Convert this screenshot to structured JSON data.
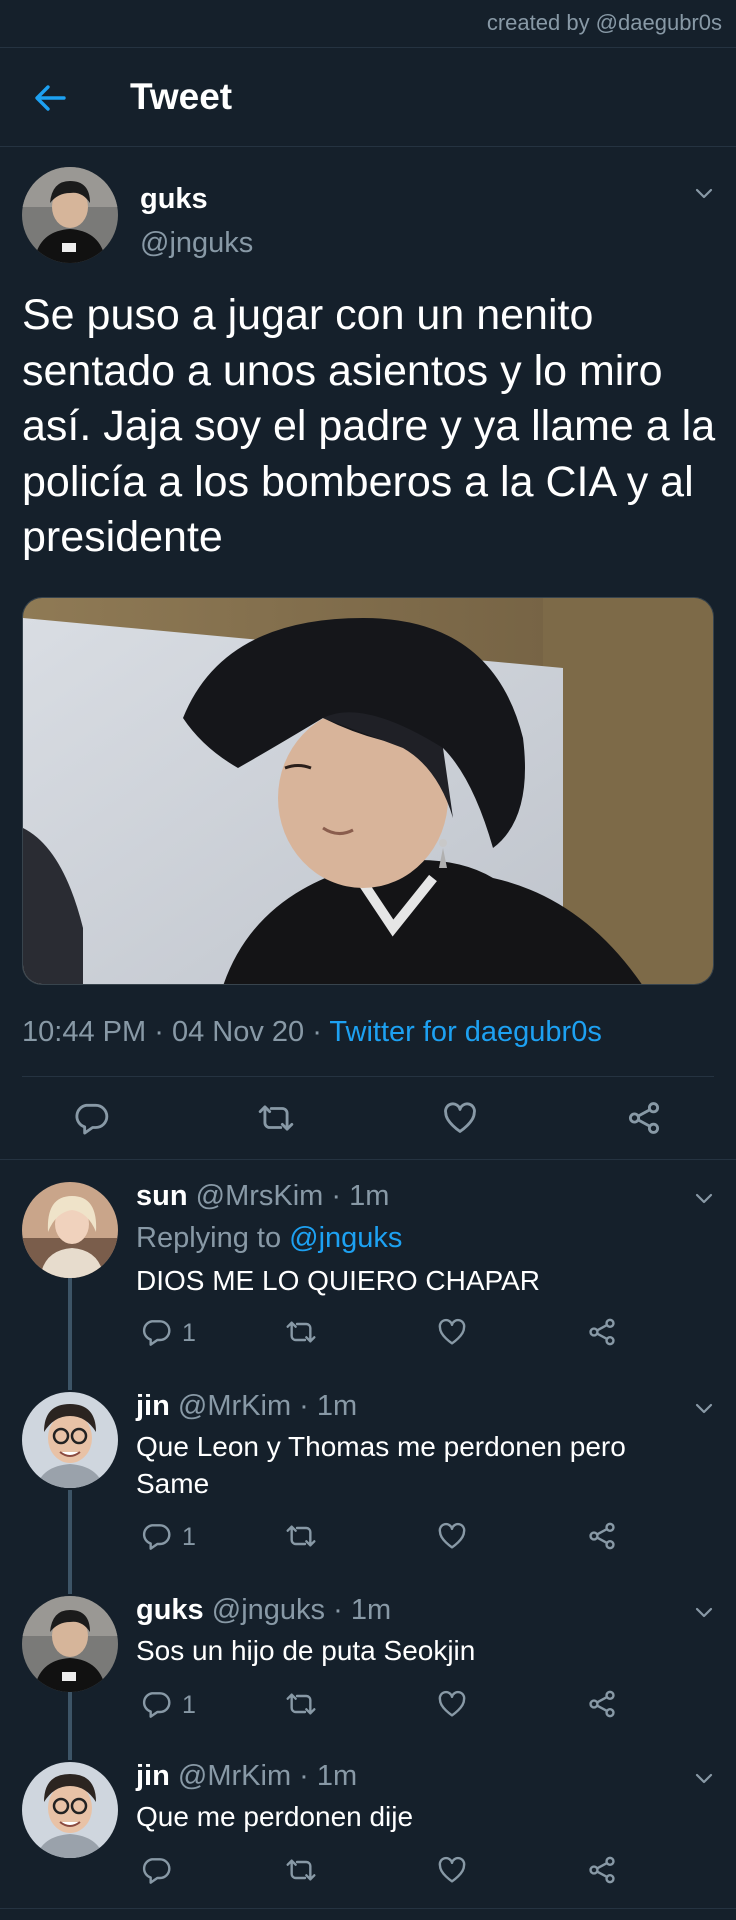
{
  "watermark": "created by @daegubr0s",
  "header": {
    "title": "Tweet",
    "back_icon": "arrow-left-icon"
  },
  "tweet": {
    "author_name": "guks",
    "author_handle": "@jnguks",
    "text": "Se puso a jugar con un nenito sentado a unos asientos y lo miro así. Jaja soy el padre y ya llame a la policía a los bomberos a la CIA y al presidente",
    "time": "10:44 PM",
    "date": "04 Nov 20",
    "separator": "·",
    "source": "Twitter for daegubr0s",
    "actions": [
      "reply-icon",
      "retweet-icon",
      "like-icon",
      "share-icon"
    ]
  },
  "replies": [
    {
      "name": "sun",
      "handle": "@MrsKim",
      "time": "1m",
      "replying_prefix": "Replying to ",
      "replying_to": "@jnguks",
      "text": "DIOS ME LO QUIERO CHAPAR",
      "reply_count": "1"
    },
    {
      "name": "jin",
      "handle": "@MrKim",
      "time": "1m",
      "text": "Que Leon y Thomas me perdonen pero Same",
      "reply_count": "1"
    },
    {
      "name": "guks",
      "handle": "@jnguks",
      "time": "1m",
      "text": "Sos un hijo de puta Seokjin",
      "reply_count": "1"
    },
    {
      "name": "jin",
      "handle": "@MrKim",
      "time": "1m",
      "text": "Que me perdonen dije",
      "reply_count": ""
    }
  ],
  "colors": {
    "background": "#15202b",
    "accent": "#1da1f2",
    "muted": "#8899a6",
    "divider": "#253341"
  }
}
